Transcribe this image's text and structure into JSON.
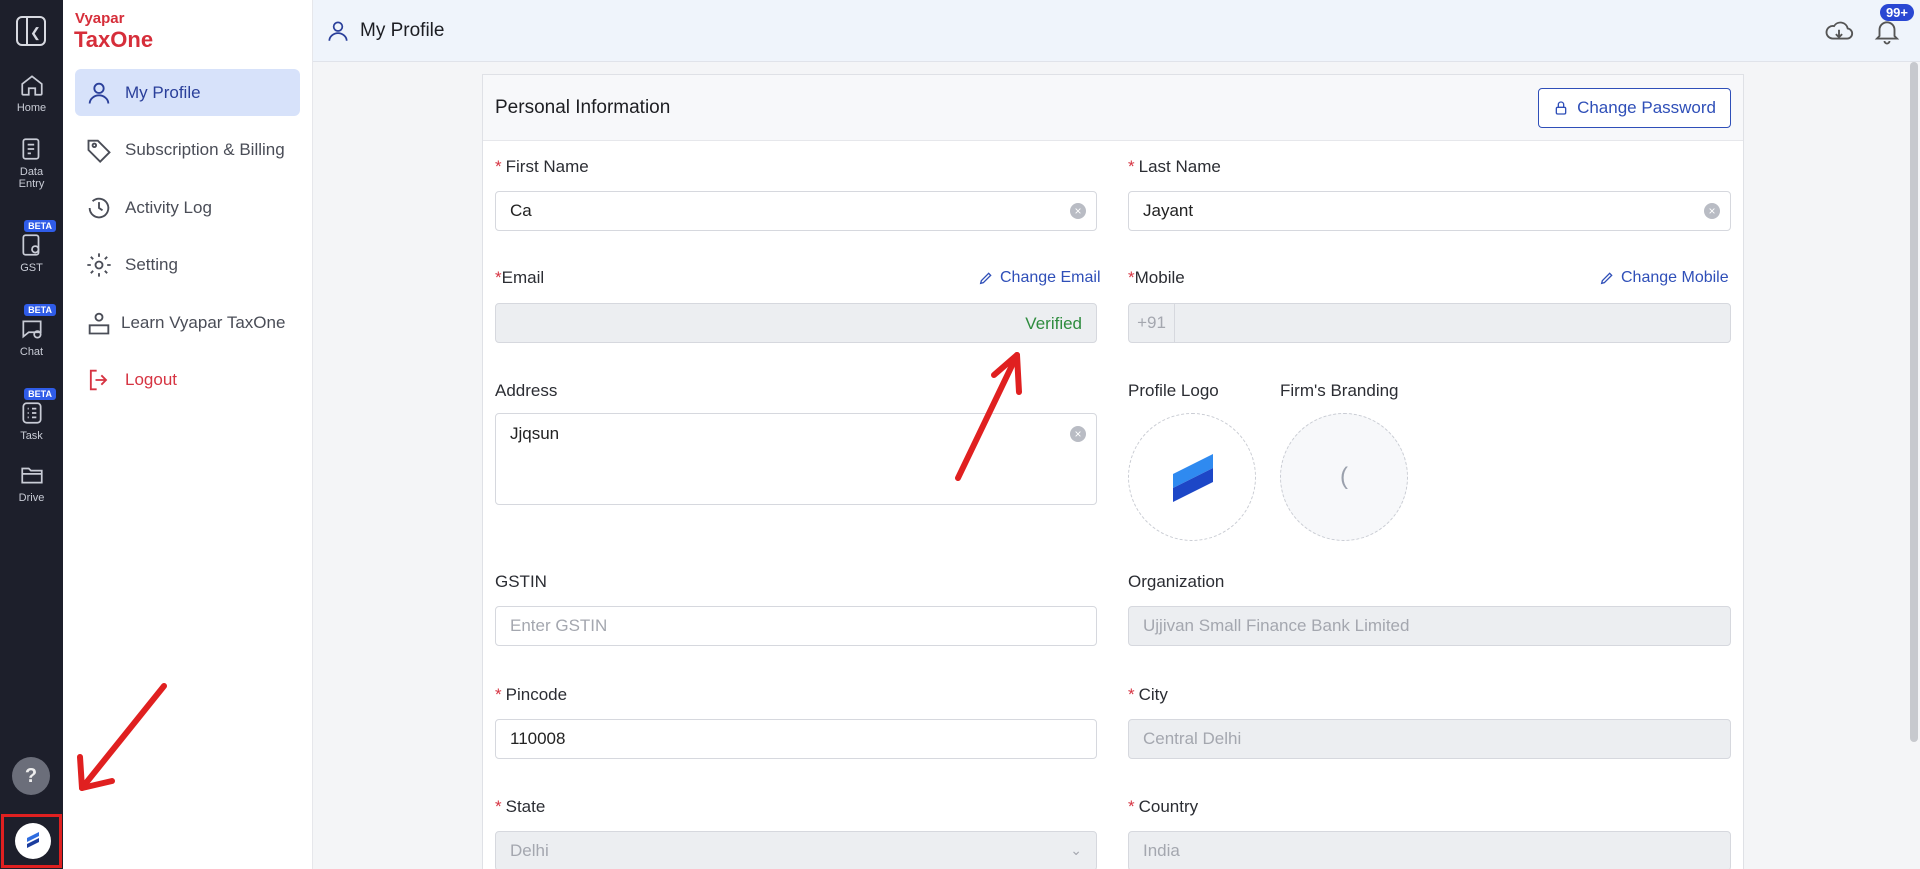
{
  "rail": {
    "items": [
      {
        "label": "Home",
        "icon": "home-icon"
      },
      {
        "label": "Data",
        "label2": "Entry",
        "icon": "data-entry-icon"
      },
      {
        "label": "GST",
        "icon": "gst-icon",
        "badge": "BETA"
      },
      {
        "label": "Chat",
        "icon": "chat-icon",
        "badge": "BETA"
      },
      {
        "label": "Task",
        "icon": "task-icon",
        "badge": "BETA"
      },
      {
        "label": "Drive",
        "icon": "drive-icon"
      }
    ],
    "help": "?"
  },
  "brand": {
    "line1": "Vyapar",
    "line2": "TaxOne"
  },
  "sidebar": {
    "items": [
      {
        "label": "My Profile"
      },
      {
        "label": "Subscription & Billing"
      },
      {
        "label": "Activity Log"
      },
      {
        "label": "Setting"
      },
      {
        "label": "Learn Vyapar TaxOne"
      },
      {
        "label": "Logout"
      }
    ]
  },
  "header": {
    "title": "My Profile",
    "notifications": "99+"
  },
  "card": {
    "title": "Personal Information",
    "change_password": "Change Password",
    "first_name": {
      "label": "First Name",
      "value": "Ca"
    },
    "last_name": {
      "label": "Last Name",
      "value": "Jayant"
    },
    "email": {
      "label": "Email",
      "value": "",
      "status": "Verified",
      "change": "Change Email"
    },
    "mobile": {
      "label": "Mobile",
      "prefix": "+91",
      "value": "",
      "change": "Change Mobile"
    },
    "address": {
      "label": "Address",
      "value": "Jjqsun"
    },
    "profile_logo": {
      "label": "Profile Logo"
    },
    "firm_branding": {
      "label": "Firm's Branding",
      "glyph": "("
    },
    "gstin": {
      "label": "GSTIN",
      "placeholder": "Enter GSTIN"
    },
    "organization": {
      "label": "Organization",
      "value": "Ujjivan Small Finance Bank Limited"
    },
    "pincode": {
      "label": "Pincode",
      "value": "110008"
    },
    "city": {
      "label": "City",
      "value": "Central Delhi"
    },
    "state": {
      "label": "State",
      "value": "Delhi"
    },
    "country": {
      "label": "Country",
      "value": "India"
    }
  },
  "colors": {
    "accent": "#2f4fb8",
    "danger": "#d63442",
    "verified": "#2e8c3e",
    "rail_bg": "#1d1f2b",
    "annotation": "#e02020"
  }
}
